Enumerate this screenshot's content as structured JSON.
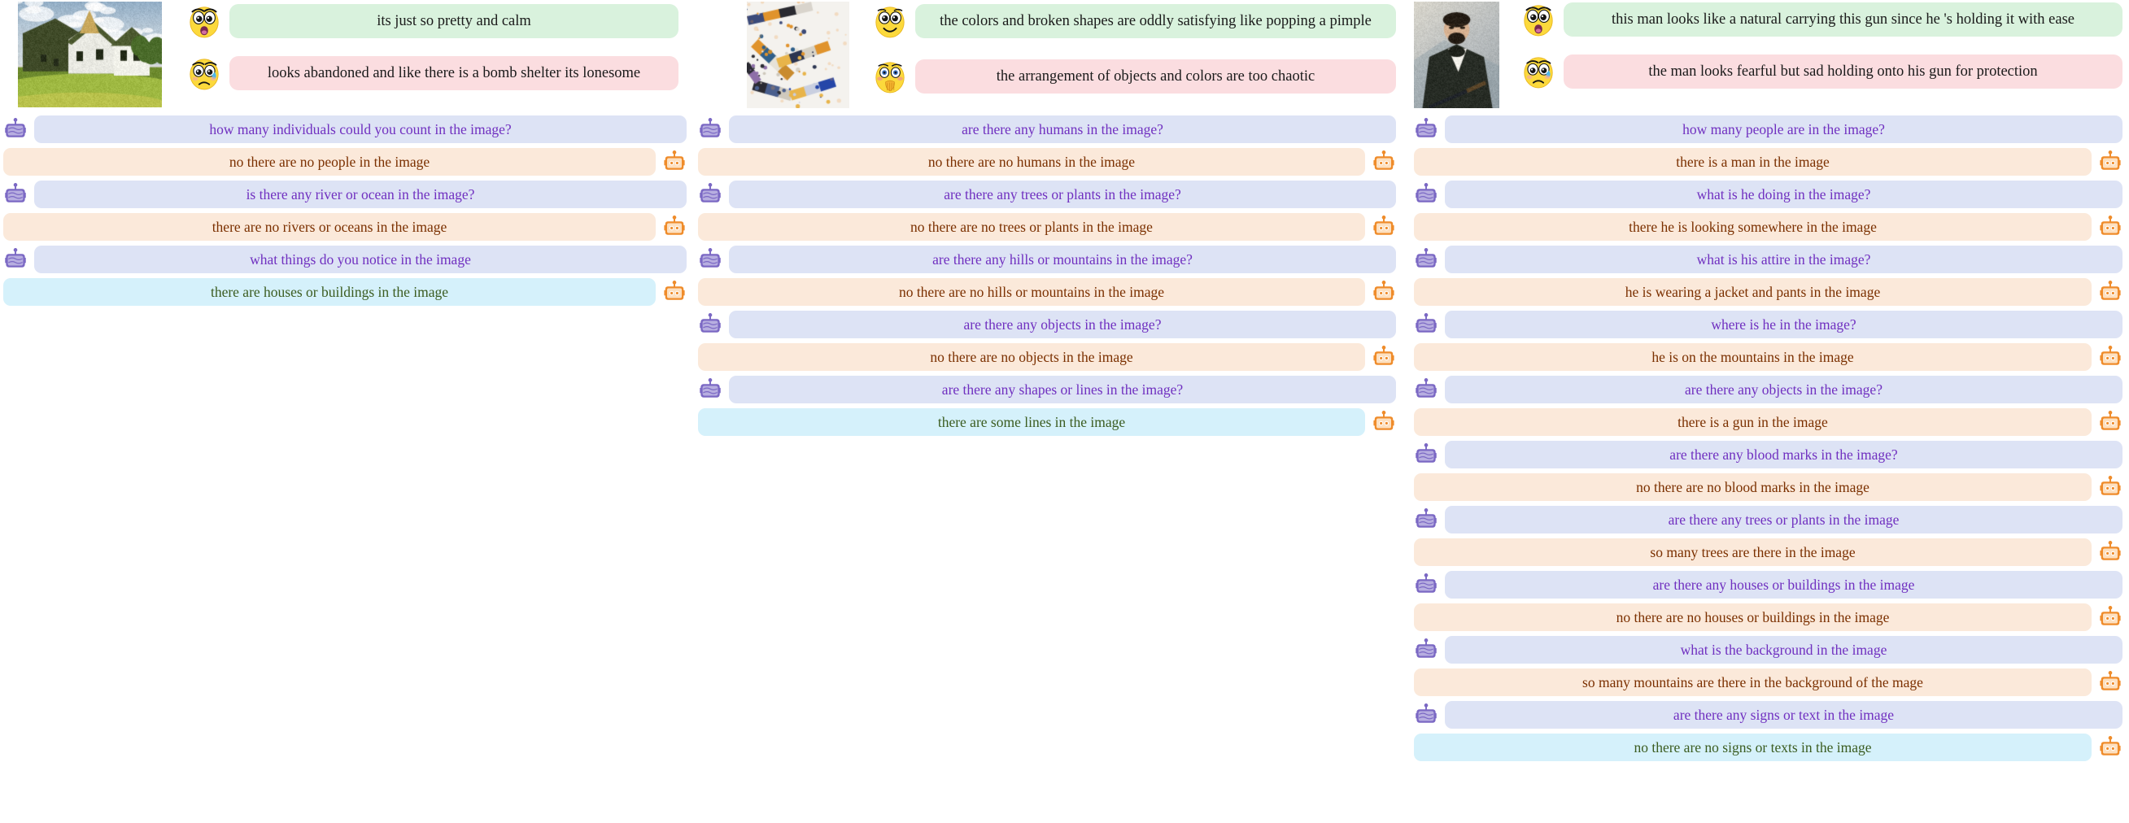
{
  "theme": {
    "positive_bubble_bg": "#d9f2dd",
    "negative_bubble_bg": "#fbdde0",
    "question_bg": "#dde3f5",
    "question_text": "#7030c0",
    "answer_bg": "#fbe9da",
    "answer_text": "#7b3000",
    "final_answer_bg": "#d5f1fb",
    "final_answer_text": "#3b5c20",
    "user_robot_color": "#7b68c4",
    "assistant_robot_color": "#ef8c2b"
  },
  "columns": [
    {
      "image": {
        "name": "house-painting",
        "alt": "painting of white and dark gabled houses with green lawn and cloudy sky"
      },
      "reactions": [
        {
          "sentiment": "positive",
          "emoji": "shocked-face-emoji",
          "text": "its just so pretty and calm"
        },
        {
          "sentiment": "negative",
          "emoji": "crying-face-emoji",
          "text": "looks abandoned and like there is a bomb shelter  its lonesome"
        }
      ],
      "dialogue": [
        {
          "role": "question",
          "text": "how many individuals could you count in the image?"
        },
        {
          "role": "answer",
          "text": "no there are no people in the image"
        },
        {
          "role": "question",
          "text": "is there any river or ocean in the image?"
        },
        {
          "role": "answer",
          "text": "there are no rivers or oceans in the image"
        },
        {
          "role": "question",
          "text": "what things do you notice in the image"
        },
        {
          "role": "answer",
          "final": true,
          "text": "there are houses or buildings in the image"
        }
      ]
    },
    {
      "image": {
        "name": "abstract-paint-strokes",
        "alt": "abstract white canvas with scattered orange blue and black paint strokes"
      },
      "reactions": [
        {
          "sentiment": "positive",
          "emoji": "smiling-face-emoji",
          "text": "the colors and broken shapes are oddly satisfying like popping a pimple"
        },
        {
          "sentiment": "negative",
          "emoji": "anxious-face-emoji",
          "text": "the arrangement of objects and colors are too chaotic"
        }
      ],
      "dialogue": [
        {
          "role": "question",
          "text": "are there any humans in the image?"
        },
        {
          "role": "answer",
          "text": "no there are no humans in the image"
        },
        {
          "role": "question",
          "text": "are there any trees or plants in the image?"
        },
        {
          "role": "answer",
          "text": "no there are no trees or plants in the image"
        },
        {
          "role": "question",
          "text": "are there any hills or mountains in the image?"
        },
        {
          "role": "answer",
          "text": "no there are no hills or mountains in the image"
        },
        {
          "role": "question",
          "text": "are there any objects in the image?"
        },
        {
          "role": "answer",
          "text": "no there are no objects in the image"
        },
        {
          "role": "question",
          "text": "are there any shapes or lines in the image?"
        },
        {
          "role": "answer",
          "final": true,
          "text": "there are some lines in the image"
        }
      ]
    },
    {
      "image": {
        "name": "man-with-gun-portrait",
        "alt": "portrait painting of a bearded man in dark jacket holding a gun"
      },
      "reactions": [
        {
          "sentiment": "positive",
          "emoji": "shocked-face-emoji",
          "text": "this man looks like a natural carrying this gun since he 's holding it with ease"
        },
        {
          "sentiment": "negative",
          "emoji": "crying-face-emoji",
          "text": "the man looks fearful but sad holding onto his gun for protection"
        }
      ],
      "dialogue": [
        {
          "role": "question",
          "text": "how many people are in the image?"
        },
        {
          "role": "answer",
          "text": "there is a man in the image"
        },
        {
          "role": "question",
          "text": "what is he doing in the image?"
        },
        {
          "role": "answer",
          "text": "there he is looking somewhere in the image"
        },
        {
          "role": "question",
          "text": "what is his attire in the image?"
        },
        {
          "role": "answer",
          "text": "he is wearing a jacket and pants in the image"
        },
        {
          "role": "question",
          "text": "where is he in the image?"
        },
        {
          "role": "answer",
          "text": "he is on the mountains in the image"
        },
        {
          "role": "question",
          "text": "are there any objects in the image?"
        },
        {
          "role": "answer",
          "text": "there is a gun in the image"
        },
        {
          "role": "question",
          "text": "are there any blood marks in the image?"
        },
        {
          "role": "answer",
          "text": "no there are no blood marks in the image"
        },
        {
          "role": "question",
          "text": "are there any trees or plants in the image"
        },
        {
          "role": "answer",
          "text": "so many trees are there in the image"
        },
        {
          "role": "question",
          "text": "are there any houses or buildings in the image"
        },
        {
          "role": "answer",
          "text": "no there are no houses or buildings in the image"
        },
        {
          "role": "question",
          "text": "what is the background in the image"
        },
        {
          "role": "answer",
          "text": "so many mountains are there in the background of the mage"
        },
        {
          "role": "question",
          "text": "are there any signs or text in the image"
        },
        {
          "role": "answer",
          "final": true,
          "text": "no there are no signs or texts in the image"
        }
      ]
    }
  ]
}
